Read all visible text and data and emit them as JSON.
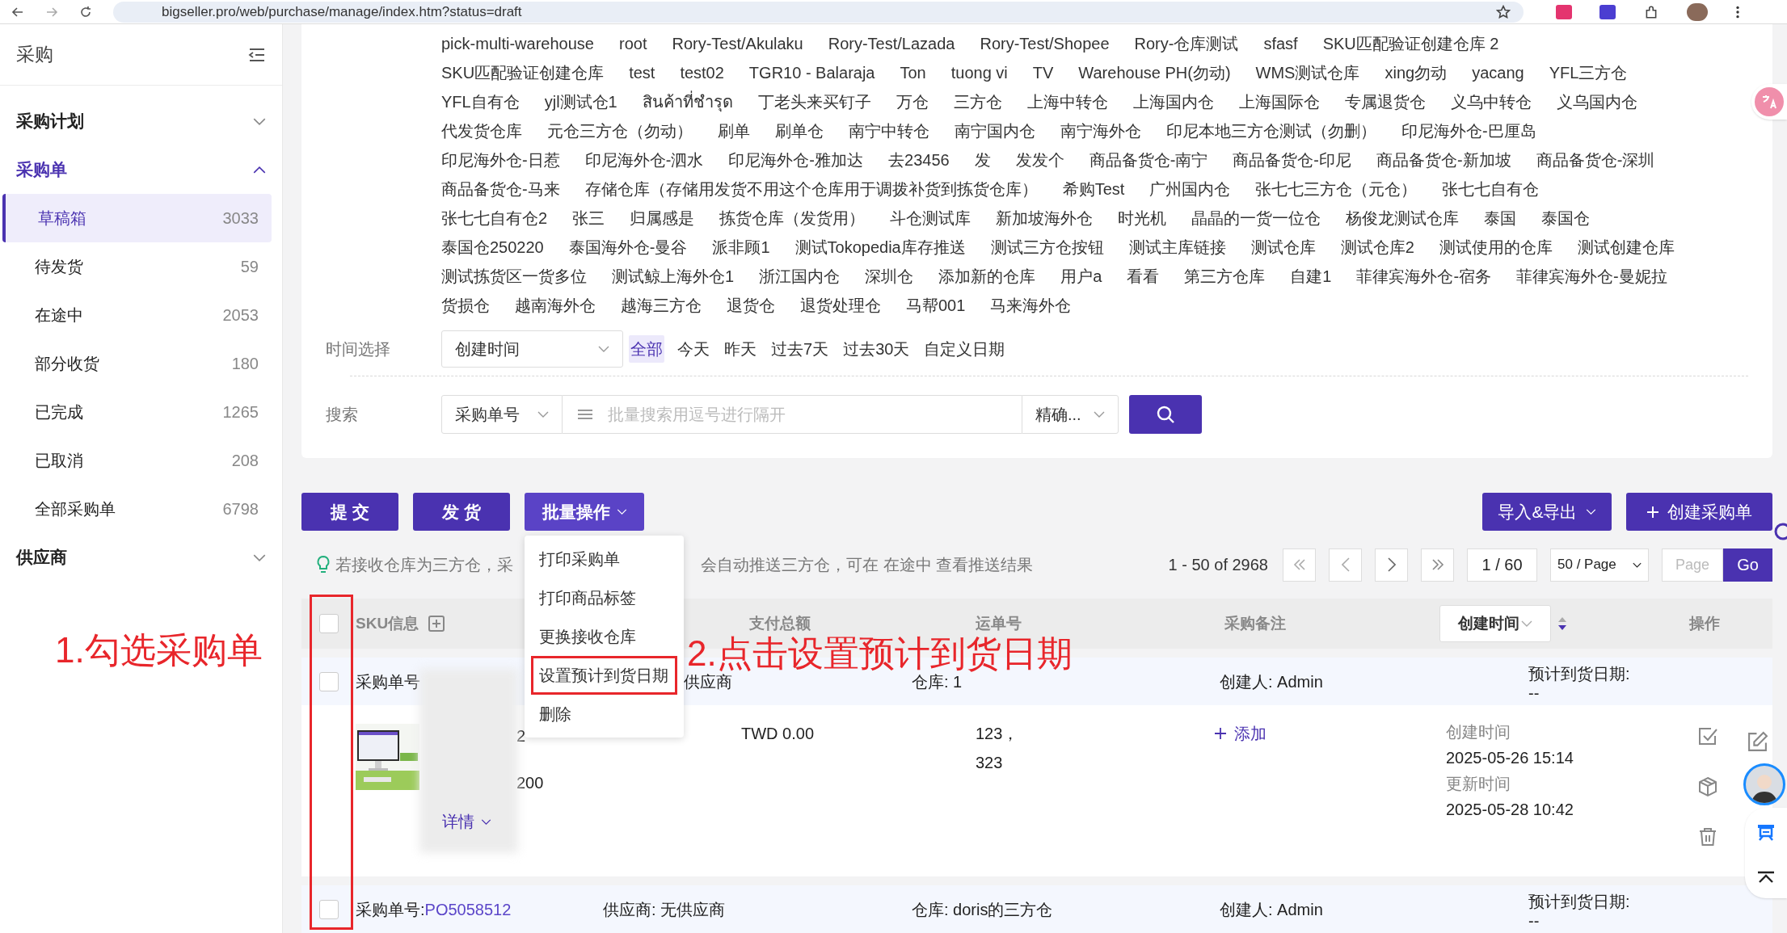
{
  "browser": {
    "url": "bigseller.pro/web/purchase/manage/index.htm?status=draft"
  },
  "sidebar": {
    "title": "采购",
    "groups": [
      {
        "label": "采购计划",
        "expanded": false,
        "selected": false
      },
      {
        "label": "采购单",
        "expanded": true,
        "selected": true,
        "items": [
          {
            "label": "草稿箱",
            "count": "3033",
            "selected": true
          },
          {
            "label": "待发货",
            "count": "59",
            "selected": false
          },
          {
            "label": "在途中",
            "count": "2053",
            "selected": false
          },
          {
            "label": "部分收货",
            "count": "180",
            "selected": false
          },
          {
            "label": "已完成",
            "count": "1265",
            "selected": false
          },
          {
            "label": "已取消",
            "count": "208",
            "selected": false
          },
          {
            "label": "全部采购单",
            "count": "6798",
            "selected": false
          }
        ]
      },
      {
        "label": "供应商",
        "expanded": false,
        "selected": false
      }
    ]
  },
  "warehouse_rows": [
    [
      "pick-multi-warehouse",
      "root",
      "Rory-Test/Akulaku",
      "Rory-Test/Lazada",
      "Rory-Test/Shopee",
      "Rory-仓库测试",
      "sfasf",
      "SKU匹配验证创建仓库 2"
    ],
    [
      "SKU匹配验证创建仓库",
      "test",
      "test02",
      "TGR10 - Balaraja",
      "Ton",
      "tuong vi",
      "TV",
      "Warehouse PH(勿动)",
      "WMS测试仓库",
      "xing勿动",
      "yacang",
      "YFL三方仓"
    ],
    [
      "YFL自有仓",
      "yjl测试仓1",
      "สินค้าที่ชำรุด",
      "丁老头来买钉子",
      "万仓",
      "三方仓",
      "上海中转仓",
      "上海国内仓",
      "上海国际仓",
      "专属退货仓",
      "义乌中转仓",
      "义乌国内仓"
    ],
    [
      "代发货仓库",
      "元仓三方仓（勿动）",
      "刷单",
      "刷单仓",
      "南宁中转仓",
      "南宁国内仓",
      "南宁海外仓",
      "印尼本地三方仓测试（勿删）",
      "印尼海外仓-巴厘岛"
    ],
    [
      "印尼海外仓-日惹",
      "印尼海外仓-泗水",
      "印尼海外仓-雅加达",
      "去23456",
      "发",
      "发发个",
      "商品备货仓-南宁",
      "商品备货仓-印尼",
      "商品备货仓-新加坡",
      "商品备货仓-深圳"
    ],
    [
      "商品备货仓-马来",
      "存储仓库（存储用发货不用这个仓库用于调拨补货到拣货仓库）",
      "希购Test",
      "广州国内仓",
      "张七七三方仓（元仓）",
      "张七七自有仓"
    ],
    [
      "张七七自有仓2",
      "张三",
      "归属感是",
      "拣货仓库（发货用）",
      "斗仓测试库",
      "新加坡海外仓",
      "时光机",
      "晶晶的一货一位仓",
      "杨俊龙测试仓库",
      "泰国",
      "泰国仓"
    ],
    [
      "泰国仓250220",
      "泰国海外仓-曼谷",
      "派非顾1",
      "测试Tokopedia库存推送",
      "测试三方仓按钮",
      "测试主库链接",
      "测试仓库",
      "测试仓库2",
      "测试使用的仓库",
      "测试创建仓库"
    ],
    [
      "测试拣货区一货多位",
      "测试鲸上海外仓1",
      "浙江国内仓",
      "深圳仓",
      "添加新的仓库",
      "用户a",
      "看看",
      "第三方仓库",
      "自建1",
      "菲律宾海外仓-宿务",
      "菲律宾海外仓-曼妮拉"
    ],
    [
      "货损仓",
      "越南海外仓",
      "越海三方仓",
      "退货仓",
      "退货处理仓",
      "马帮001",
      "马来海外仓"
    ]
  ],
  "time_filter": {
    "label": "时间选择",
    "field": "创建时间",
    "options": [
      {
        "label": "全部",
        "selected": true
      },
      {
        "label": "今天",
        "selected": false
      },
      {
        "label": "昨天",
        "selected": false
      },
      {
        "label": "过去7天",
        "selected": false
      },
      {
        "label": "过去30天",
        "selected": false
      },
      {
        "label": "自定义日期",
        "selected": false
      }
    ]
  },
  "search": {
    "label": "搜索",
    "type_field": "采购单号",
    "placeholder": "批量搜索用逗号进行隔开",
    "mode": "精确..."
  },
  "actions": {
    "left": [
      "提 交",
      "发 货"
    ],
    "batch": {
      "label": "批量操作",
      "expanded": true,
      "menu": [
        {
          "label": "打印采购单",
          "outlined": false
        },
        {
          "label": "打印商品标签",
          "outlined": false
        },
        {
          "label": "更换接收仓库",
          "outlined": false
        },
        {
          "label": "设置预计到货日期",
          "outlined": true
        },
        {
          "label": "删除",
          "outlined": false
        }
      ]
    },
    "import_export": "导入&导出",
    "create": "创建采购单"
  },
  "tip": {
    "before": "若接收仓库为三方仓，采",
    "after": "会自动推送三方仓，可在 在途中 查看推送结果"
  },
  "pagination": {
    "range": "1 - 50 of 2968",
    "page": "1 / 60",
    "page_size": "50 / Page",
    "jump_placeholder": "Page",
    "go": "Go"
  },
  "table": {
    "header_checked": false,
    "checkbox_column_outlined": true,
    "columns": [
      "SKU信息",
      "支付总额",
      "运单号",
      "采购备注",
      "创建时间",
      "操作"
    ],
    "rows": [
      {
        "checked": false,
        "order_label": "采购单号",
        "supplier": "供应商",
        "warehouse": "仓库: 1",
        "creator": "创建人: Admin",
        "eta_label": "预计到货日期:",
        "eta": "--",
        "sku_lines": [
          "2",
          "200"
        ],
        "details": "详情",
        "amount": "TWD 0.00",
        "tracking": [
          "123，",
          "323"
        ],
        "remark_link": "添加",
        "created_label": "创建时间",
        "created": "2025-05-26 15:14",
        "updated_label": "更新时间",
        "updated": "2025-05-28 10:42"
      },
      {
        "checked": false,
        "order_label": "采购单号:",
        "order_no": "PO5058512",
        "supplier": "供应商: 无供应商",
        "warehouse": "仓库: doris的三方仓",
        "creator": "创建人: Admin",
        "eta_label": "预计到货日期:",
        "eta": "--"
      }
    ]
  },
  "annotations": [
    {
      "kind": "callout",
      "text": "1.勾选采购单"
    },
    {
      "kind": "callout",
      "text": "2.点击设置预计到货日期"
    }
  ]
}
